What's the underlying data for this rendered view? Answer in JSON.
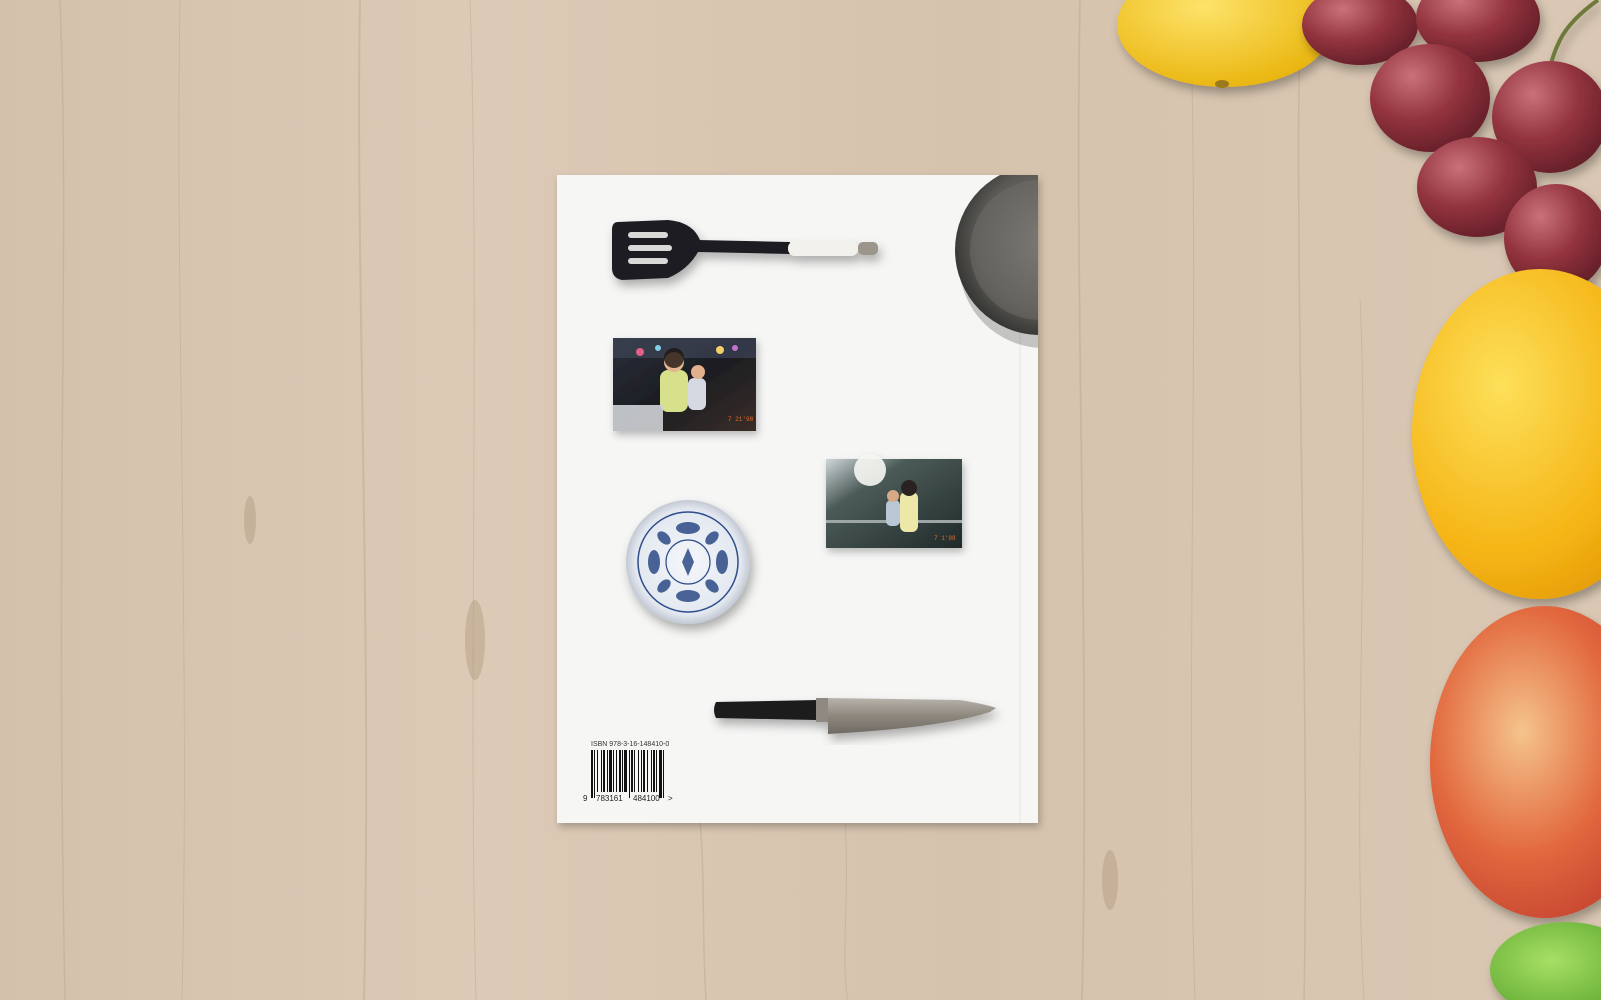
{
  "scene": {
    "description_free": true,
    "background": "wood-table",
    "colors": {
      "wood": "#d9c7b2",
      "wood_dark": "#b9a38b",
      "cover": "#f6f6f5",
      "lemon": "#f5c81a",
      "orange": "#f7b51c",
      "grape": "#8a2c35",
      "apple": "#d9492f",
      "lime": "#6cbf3a"
    }
  },
  "book": {
    "isbn_label": "ISBN 978-3-16-148410-0",
    "barcode_digits": {
      "first": "9",
      "left_group": "783161",
      "right_group": "484100",
      "end_mark": ">"
    }
  },
  "photos": [
    {
      "date_stamp": "7 21'98"
    },
    {
      "date_stamp": "7 1'98"
    }
  ],
  "objects": [
    {
      "icon": "spatula-icon"
    },
    {
      "icon": "pan-icon"
    },
    {
      "icon": "bowl-icon"
    },
    {
      "icon": "knife-icon"
    },
    {
      "icon": "lemon-icon"
    },
    {
      "icon": "grapes-icon"
    },
    {
      "icon": "orange-icon"
    },
    {
      "icon": "apple-icon"
    },
    {
      "icon": "lime-icon"
    }
  ]
}
